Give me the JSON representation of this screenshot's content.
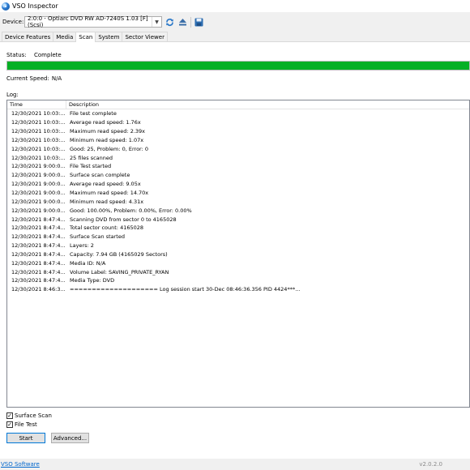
{
  "window": {
    "title": "VSO Inspector"
  },
  "toolbar": {
    "device_label": "Device:",
    "device_value": "2:0:0 - Optiarc DVD RW AD-7240S 1.03 [F] (Scsi)",
    "refresh_icon": "refresh-icon",
    "eject_icon": "eject-icon",
    "save_icon": "save-icon"
  },
  "tabs": [
    {
      "label": "Device Features"
    },
    {
      "label": "Media"
    },
    {
      "label": "Scan"
    },
    {
      "label": "System"
    },
    {
      "label": "Sector Viewer"
    }
  ],
  "scan": {
    "status_label": "Status:",
    "status_value": "Complete",
    "progress_percent": 100,
    "progress_color": "#06b025",
    "speed_label": "Current Speed:",
    "speed_value": "N/A",
    "log_label": "Log:",
    "log_columns": {
      "time": "Time",
      "description": "Description"
    },
    "log_rows": [
      {
        "time": "12/30/2021 10:03:...",
        "description": "File test complete"
      },
      {
        "time": "12/30/2021 10:03:...",
        "description": "Average read speed: 1.76x"
      },
      {
        "time": "12/30/2021 10:03:...",
        "description": "Maximum read speed: 2.39x"
      },
      {
        "time": "12/30/2021 10:03:...",
        "description": "Minimum read speed: 1.07x"
      },
      {
        "time": "12/30/2021 10:03:...",
        "description": "Good: 25, Problem: 0, Error: 0"
      },
      {
        "time": "12/30/2021 10:03:...",
        "description": "25 files scanned"
      },
      {
        "time": "12/30/2021 9:00:0...",
        "description": "File Test started"
      },
      {
        "time": "12/30/2021 9:00:0...",
        "description": "Surface scan complete"
      },
      {
        "time": "12/30/2021 9:00:0...",
        "description": "Average read speed: 9.05x"
      },
      {
        "time": "12/30/2021 9:00:0...",
        "description": "Maximum read speed: 14.70x"
      },
      {
        "time": "12/30/2021 9:00:0...",
        "description": "Minimum read speed: 4.31x"
      },
      {
        "time": "12/30/2021 9:00:0...",
        "description": "Good: 100.00%, Problem: 0.00%, Error: 0.00%"
      },
      {
        "time": "12/30/2021 8:47:4...",
        "description": "Scanning DVD from sector 0 to 4165028"
      },
      {
        "time": "12/30/2021 8:47:4...",
        "description": "Total sector count: 4165028"
      },
      {
        "time": "12/30/2021 8:47:4...",
        "description": "Surface Scan started"
      },
      {
        "time": "12/30/2021 8:47:4...",
        "description": "Layers: 2"
      },
      {
        "time": "12/30/2021 8:47:4...",
        "description": "Capacity: 7.94 GB (4165029 Sectors)"
      },
      {
        "time": "12/30/2021 8:47:4...",
        "description": "Media ID: N/A"
      },
      {
        "time": "12/30/2021 8:47:4...",
        "description": "Volume Label: SAVING_PRIVATE_RYAN"
      },
      {
        "time": "12/30/2021 8:47:4...",
        "description": "Media Type: DVD"
      },
      {
        "time": "12/30/2021 8:46:3...",
        "description": "==================== Log session start 30-Dec 08:46:36.356 PID 4424***..."
      }
    ],
    "surface_scan_label": "Surface Scan",
    "surface_scan_checked": true,
    "file_test_label": "File Test",
    "file_test_checked": true,
    "start_label": "Start",
    "advanced_label": "Advanced..."
  },
  "footer": {
    "link_text": "VSO Software",
    "version": "v2.0.2.0"
  }
}
